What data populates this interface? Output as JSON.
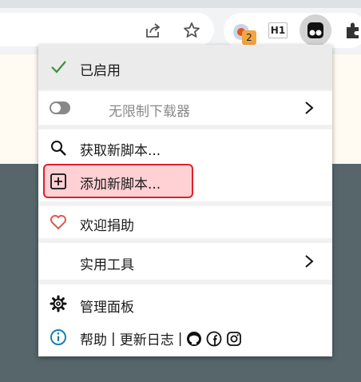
{
  "toolbar": {
    "share_icon": "share-icon",
    "bookmark_icon": "star-icon",
    "extension_badge": "2",
    "h1_extension_label": "H1",
    "tampermonkey_icon": "tampermonkey-icon",
    "extensions_icon": "puzzle-icon"
  },
  "menu": {
    "enabled_label": "已启用",
    "script_name": "无限制下载器",
    "get_new_scripts": "获取新脚本...",
    "add_new_script": "添加新脚本...",
    "donate": "欢迎捐助",
    "utilities": "实用工具",
    "dashboard": "管理面板",
    "help": "帮助",
    "sep1": "|",
    "changelog": "更新日志",
    "sep2": "|"
  },
  "colors": {
    "check": "#3a8f3a",
    "heart": "#e0574a",
    "highlight_border": "#e0202a",
    "highlight_fill": "#ffd0d4",
    "info": "#1a7fb0"
  }
}
